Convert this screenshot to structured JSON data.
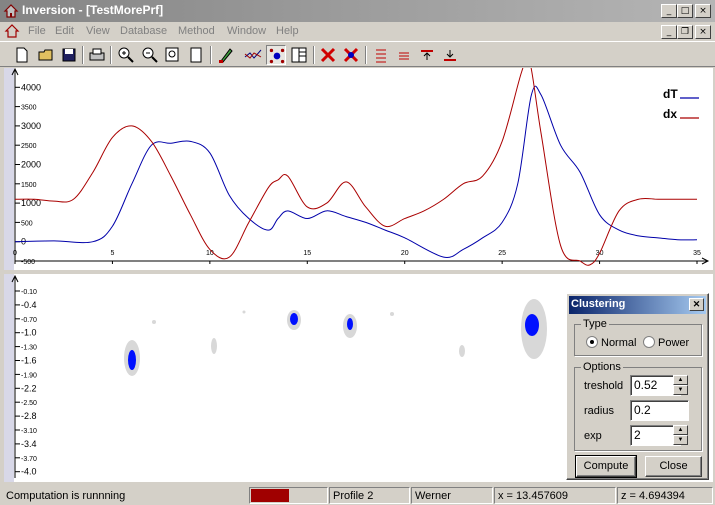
{
  "window": {
    "title": "Inversion - [TestMorePrf]"
  },
  "menu": [
    "File",
    "Edit",
    "View",
    "Database",
    "Method",
    "Window",
    "Help"
  ],
  "toolbar": [
    {
      "name": "new-file-icon"
    },
    {
      "name": "open-folder-icon"
    },
    {
      "name": "save-icon"
    },
    {
      "name": "print-icon"
    },
    {
      "name": "zoom-in-icon"
    },
    {
      "name": "zoom-out-icon"
    },
    {
      "name": "zoom-fit-icon"
    },
    {
      "name": "page-icon"
    },
    {
      "name": "pen-icon"
    },
    {
      "name": "line-select-icon"
    },
    {
      "name": "cluster-icon"
    },
    {
      "name": "split-view-icon"
    },
    {
      "name": "delete-red-icon"
    },
    {
      "name": "delete-blue-icon"
    },
    {
      "name": "align-lines-icon"
    },
    {
      "name": "align-equal-icon"
    },
    {
      "name": "align-top-icon"
    },
    {
      "name": "align-bottom-icon"
    }
  ],
  "colors": {
    "dT": "#0000aa",
    "dx": "#aa0000",
    "accent": "#0a246a",
    "cluster": "#0010ff"
  },
  "chart_data": [
    {
      "type": "line",
      "xlim": [
        0,
        35
      ],
      "ylim": [
        -500,
        4500
      ],
      "x_ticks": [
        "0",
        "5",
        "10",
        "15",
        "20",
        "25",
        "30",
        "35"
      ],
      "y_ticks_large": [
        "4000",
        "3000",
        "2000",
        "1000",
        "0"
      ],
      "y_ticks_small": [
        "3500",
        "2500",
        "1500",
        "500",
        "-500"
      ],
      "legend": [
        "dT",
        "dx"
      ],
      "series": [
        {
          "name": "dT",
          "color": "#0000aa",
          "x": [
            0,
            2,
            4,
            5,
            6,
            7,
            8,
            9,
            10,
            11,
            12,
            13,
            13.5,
            14,
            15,
            16,
            17,
            18,
            19,
            20,
            22,
            23,
            24,
            25,
            25.8,
            26.5,
            27,
            28,
            29,
            30,
            31,
            32,
            33,
            34,
            35
          ],
          "y": [
            0,
            20,
            0,
            400,
            1500,
            2500,
            2550,
            2600,
            2300,
            1200,
            600,
            300,
            600,
            800,
            600,
            800,
            650,
            500,
            300,
            100,
            -400,
            -200,
            100,
            500,
            1500,
            3800,
            3800,
            2500,
            1800,
            700,
            300,
            150,
            100,
            50,
            50
          ]
        },
        {
          "name": "dx",
          "color": "#aa0000",
          "x": [
            0,
            1,
            2,
            3,
            4,
            5,
            6,
            7,
            8,
            9,
            10,
            11,
            12,
            13,
            13.5,
            14,
            15,
            16,
            17,
            18,
            19,
            20,
            21,
            22,
            23,
            24,
            25,
            26,
            26.4,
            27,
            28,
            29,
            29.5,
            30,
            31,
            32,
            33,
            34,
            35
          ],
          "y": [
            1100,
            1100,
            1050,
            1100,
            1800,
            2700,
            3000,
            2600,
            1700,
            700,
            -200,
            -400,
            500,
            1400,
            1600,
            1700,
            900,
            1000,
            1550,
            900,
            400,
            600,
            800,
            1100,
            1500,
            1700,
            2600,
            4400,
            4700,
            2800,
            -100,
            -500,
            -600,
            -300,
            800,
            1100,
            1100,
            1100,
            1100
          ]
        }
      ]
    },
    {
      "type": "scatter",
      "y_ticks": [
        "-0.10",
        "-0.4",
        "-0.70",
        "-1.0",
        "-1.30",
        "-1.6",
        "-1.90",
        "-2.2",
        "-2.50",
        "-2.8",
        "-3.10",
        "-3.4",
        "-3.70",
        "-4.0"
      ]
    }
  ],
  "dialog": {
    "title": "Clustering",
    "type_group": "Type",
    "type_options": [
      "Normal",
      "Power"
    ],
    "type_selected": "Normal",
    "options_group": "Options",
    "treshold_label": "treshold",
    "treshold_value": "0.52",
    "radius_label": "radius",
    "radius_value": "0.2",
    "exp_label": "exp",
    "exp_value": "2",
    "compute_label": "Compute",
    "close_label": "Close"
  },
  "status": {
    "message": "Computation is runnning",
    "progress": 0.5,
    "profile": "Profile 2",
    "method": "Werner",
    "x": "x = 13.457609",
    "z": "z = 4.694394"
  }
}
